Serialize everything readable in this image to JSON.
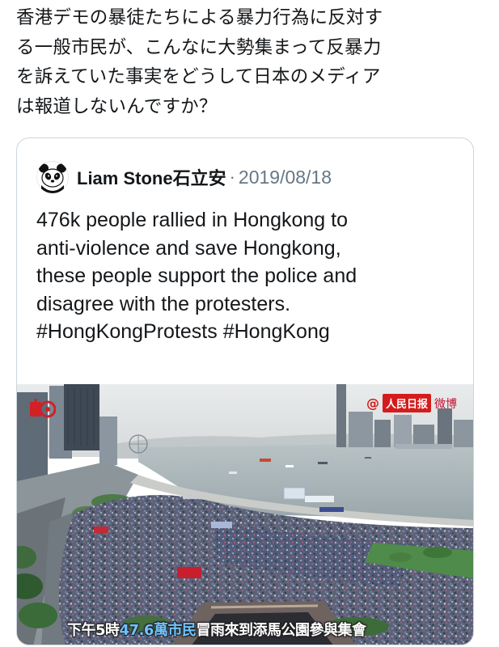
{
  "tweet": {
    "text": "香港デモの暴徒たちによる暴力行為に反対す\nる一般市民が、こんなに大勢集まって反暴力\nを訴えていた事実をどうして日本のメディア\nは報道しないんですか？"
  },
  "quoted_tweet": {
    "author_name": "Liam Stone石立安",
    "separator": "·",
    "date": "2019/08/18",
    "text": "476k people rallied in Hongkong to\nanti-violence and save Hongkong,\nthese people support the police and\ndisagree with the protesters.\n#HongKongProtests #HongKong",
    "avatar_icon": "panda-avatar-icon",
    "media": {
      "caption_prefix": "下午5時",
      "caption_highlight": "47.6萬市民",
      "caption_suffix": "冒雨來到添馬公園參與集會",
      "watermark_at": "@",
      "watermark_brand": "人民日报",
      "watermark_platform": "微博"
    }
  },
  "colors": {
    "text_primary": "#14171a",
    "text_secondary": "#657786",
    "card_border": "#ccd6dd",
    "caption_highlight": "#6ec3ff"
  }
}
